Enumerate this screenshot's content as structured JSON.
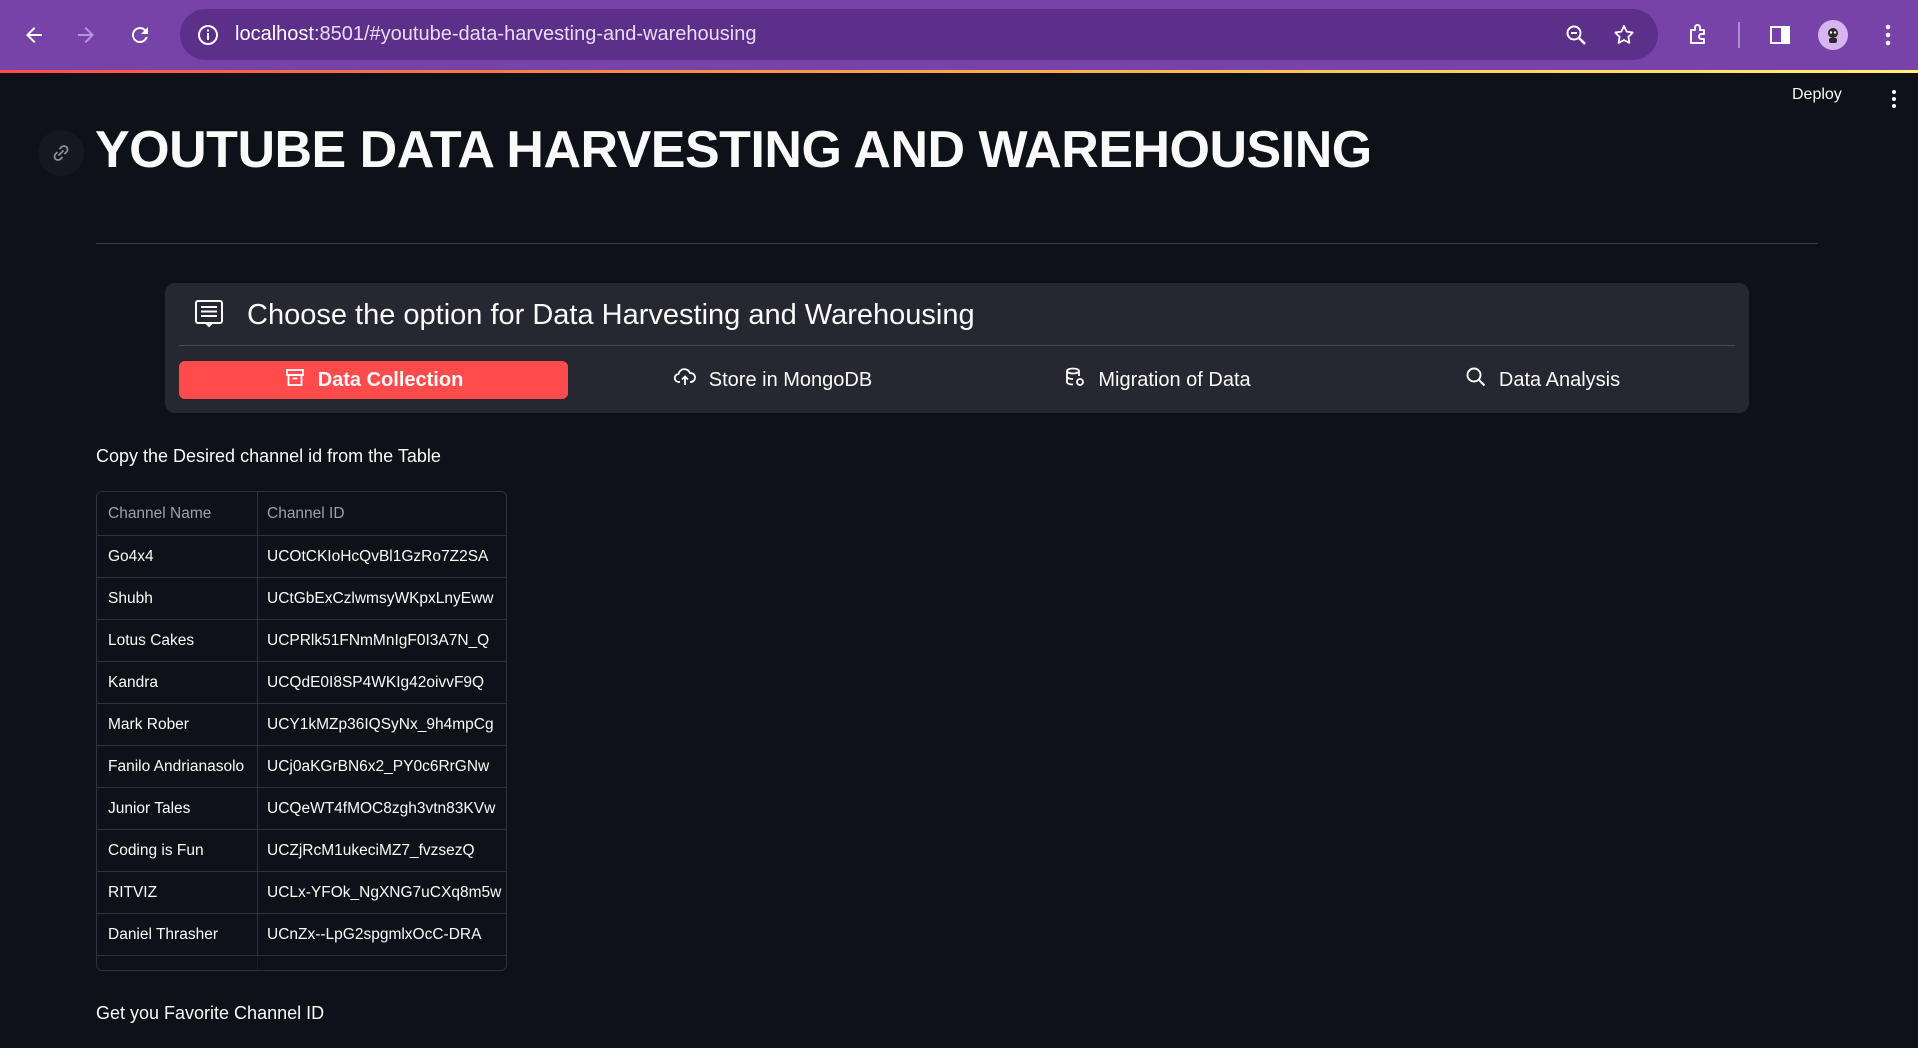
{
  "browser": {
    "url_host": "localhost",
    "url_rest": ":8501/#youtube-data-harvesting-and-warehousing"
  },
  "app": {
    "deploy_label": "Deploy",
    "title": "YOUTUBE DATA HARVESTING AND WAREHOUSING"
  },
  "option_menu": {
    "title": "Choose the option for Data Harvesting and Warehousing",
    "items": [
      {
        "label": "Data Collection",
        "icon": "archive-icon",
        "active": true
      },
      {
        "label": "Store in MongoDB",
        "icon": "cloud-upload-icon",
        "active": false
      },
      {
        "label": "Migration of Data",
        "icon": "database-gear-icon",
        "active": false
      },
      {
        "label": "Data Analysis",
        "icon": "search-icon",
        "active": false
      }
    ]
  },
  "instructions": {
    "copy_label": "Copy the Desired channel id from the Table",
    "favorite_label": "Get you Favorite Channel ID"
  },
  "table": {
    "columns": [
      "Channel Name",
      "Channel ID"
    ],
    "rows": [
      [
        "Go4x4",
        "UCOtCKIoHcQvBl1GzRo7Z2SA"
      ],
      [
        "Shubh",
        "UCtGbExCzlwmsyWKpxLnyEww"
      ],
      [
        "Lotus Cakes",
        "UCPRlk51FNmMnIgF0I3A7N_Q"
      ],
      [
        "Kandra",
        "UCQdE0I8SP4WKIg42oivvF9Q"
      ],
      [
        "Mark Rober",
        "UCY1kMZp36IQSyNx_9h4mpCg"
      ],
      [
        "Fanilo Andrianasolo",
        "UCj0aKGrBN6x2_PY0c6RrGNw"
      ],
      [
        "Junior Tales",
        "UCQeWT4fMOC8zgh3vtn83KVw"
      ],
      [
        "Coding is Fun",
        "UCZjRcM1ukeciMZ7_fvzsezQ"
      ],
      [
        "RITVIZ",
        "UCLx-YFOk_NgXNG7uCXq8m5w"
      ],
      [
        "Daniel Thrasher",
        "UCnZx--LpG2spgmlxOcC-DRA"
      ]
    ]
  },
  "colors": {
    "accent": "#ff4b4b",
    "background": "#0e1117",
    "menu_bg": "#262730",
    "browser_bar": "#7843a8"
  }
}
